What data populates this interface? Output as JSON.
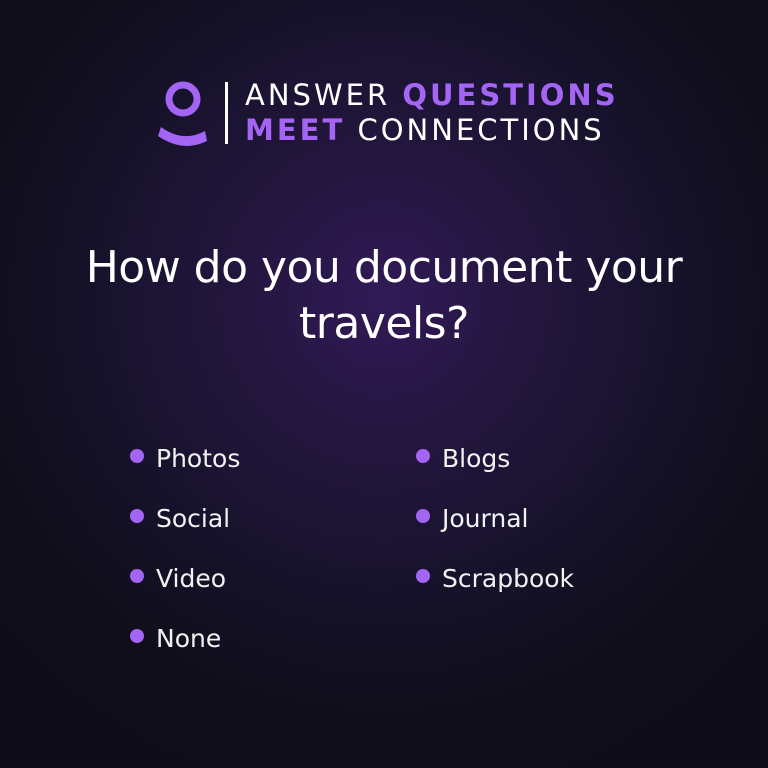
{
  "brand": {
    "line1_part1": "ANSWER",
    "line1_part2": "QUESTIONS",
    "line2_part1": "MEET",
    "line2_part2": "CONNECTIONS",
    "icon": "person-icon",
    "accent_color": "#a465f5"
  },
  "question": {
    "line1": "How do you document your",
    "line2": "travels?"
  },
  "options": {
    "left": [
      "Photos",
      "Social",
      "Video",
      "None"
    ],
    "right": [
      "Blogs",
      "Journal",
      "Scrapbook"
    ]
  }
}
